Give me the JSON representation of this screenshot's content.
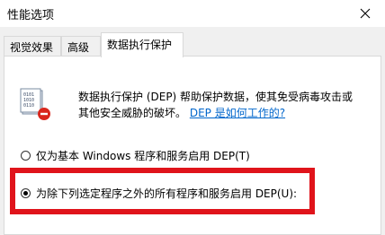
{
  "window": {
    "title": "性能选项"
  },
  "tabs": [
    {
      "label": "视觉效果"
    },
    {
      "label": "高级"
    },
    {
      "label": "数据执行保护"
    }
  ],
  "dep": {
    "description_line1": "数据执行保护 (DEP) 帮助保护数据，使其免受病毒攻击或",
    "description_line2": "其他安全威胁的破坏。",
    "help_link": "DEP 是如何工作的?"
  },
  "options": [
    {
      "label": "仅为基本 Windows 程序和服务启用 DEP(T)",
      "selected": false
    },
    {
      "label": "为除下列选定程序之外的所有程序和服务启用 DEP(U):",
      "selected": true
    }
  ],
  "colors": {
    "highlight": "#e0141b",
    "link": "#0066cc"
  }
}
